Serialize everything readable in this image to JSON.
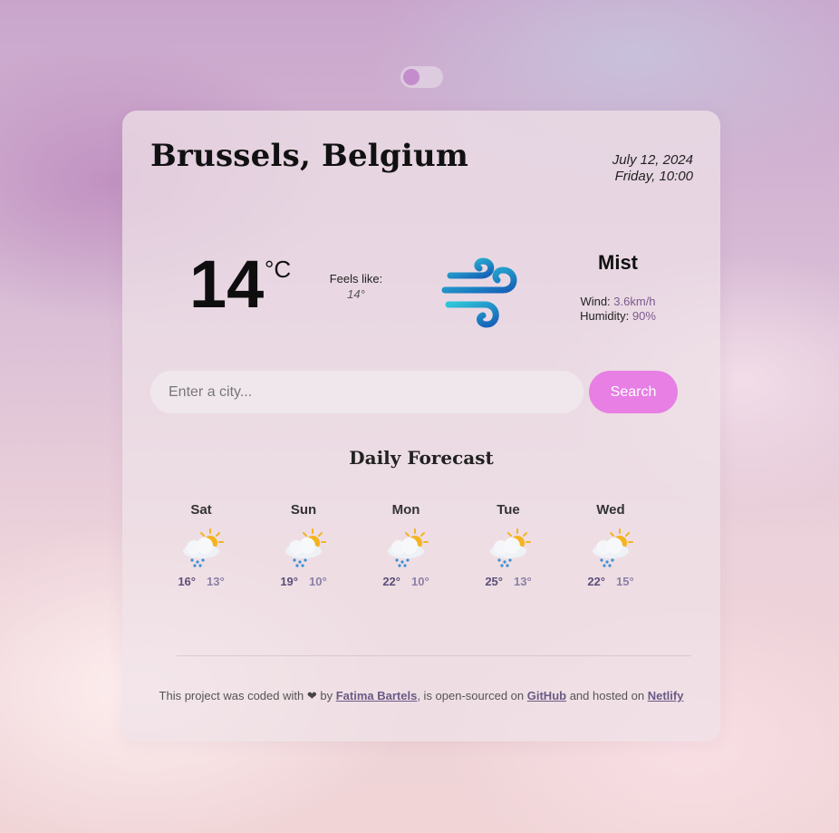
{
  "header": {
    "city": "Brussels, Belgium",
    "date": "July 12, 2024",
    "day_time": "Friday, 10:00"
  },
  "current": {
    "temperature": "14",
    "unit": "°C",
    "feels_label": "Feels like:",
    "feels_value": "14°",
    "icon": "wind-icon",
    "description": "Mist",
    "wind_label": "Wind:",
    "wind_value": "3.6km/h",
    "humidity_label": "Humidity:",
    "humidity_value": "90%"
  },
  "search": {
    "placeholder": "Enter a city...",
    "button_label": "Search"
  },
  "forecast": {
    "title": "Daily Forecast",
    "days": [
      {
        "day": "Sat",
        "max": "16°",
        "min": "13°",
        "icon": "sun-cloud-rain-icon"
      },
      {
        "day": "Sun",
        "max": "19°",
        "min": "10°",
        "icon": "sun-cloud-rain-icon"
      },
      {
        "day": "Mon",
        "max": "22°",
        "min": "10°",
        "icon": "sun-cloud-rain-icon"
      },
      {
        "day": "Tue",
        "max": "25°",
        "min": "13°",
        "icon": "sun-cloud-rain-icon"
      },
      {
        "day": "Wed",
        "max": "22°",
        "min": "15°",
        "icon": "sun-cloud-rain-icon"
      }
    ]
  },
  "footer": {
    "text1": "This project was coded with",
    "heart": "❤",
    "text2": "by",
    "author": "Fatima Bartels",
    "text3": ", is open-sourced on",
    "github": "GitHub",
    "text4": "and hosted on",
    "netlify": "Netlify"
  },
  "colors": {
    "accent": "#e77fe4",
    "toggle_knob": "#c48ccc",
    "highlight_text": "#7b5a8f"
  }
}
